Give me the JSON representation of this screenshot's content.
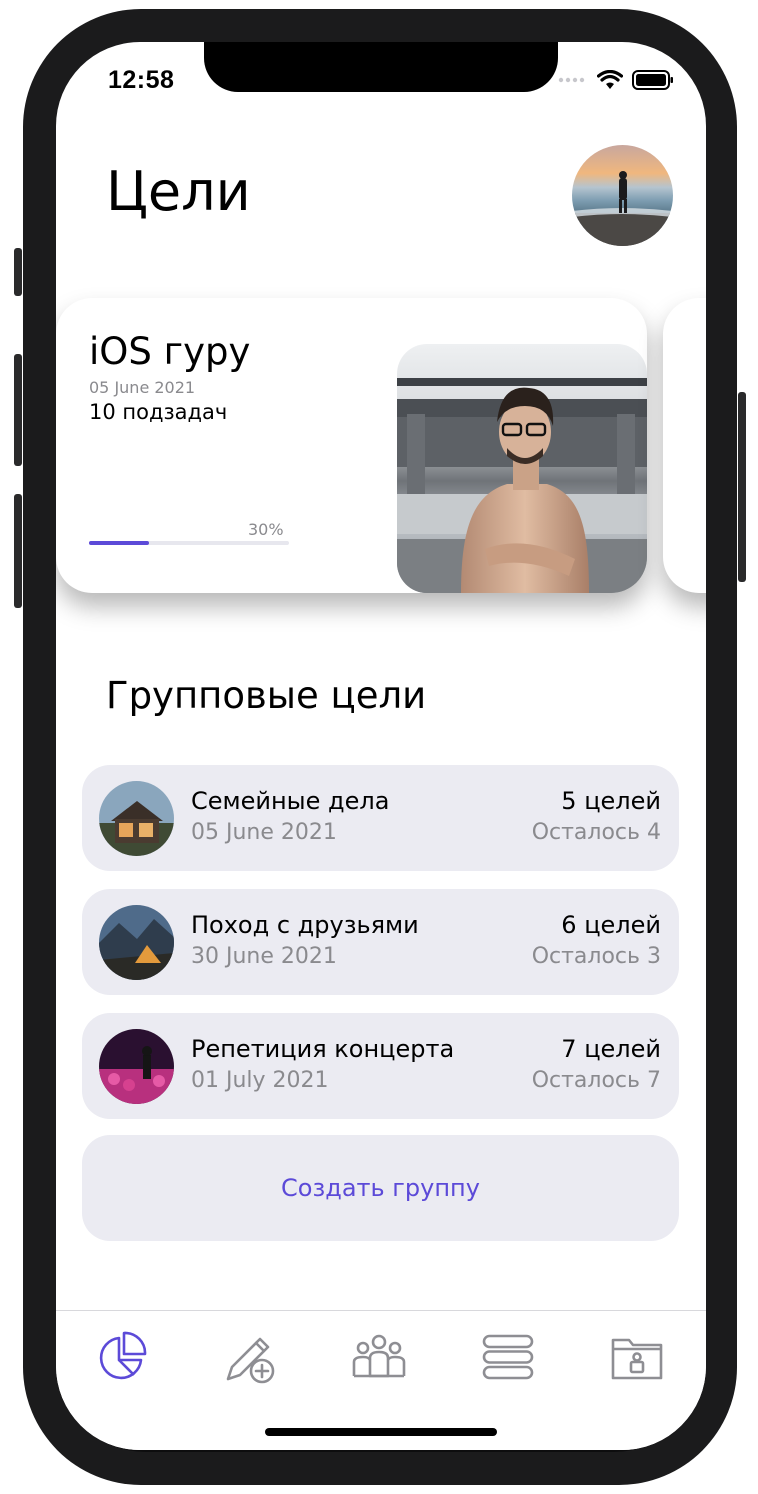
{
  "status_bar": {
    "time": "12:58"
  },
  "header": {
    "title": "Цели"
  },
  "goal_card": {
    "title": "iOS гуру",
    "date": "05 June 2021",
    "subtasks": "10 подзадач",
    "progress_label": "30%",
    "progress": 0.3
  },
  "groups": {
    "title": "Групповые цели",
    "items": [
      {
        "name": "Семейные дела",
        "date": "05 June 2021",
        "count": "5 целей",
        "remaining": "Осталось 4"
      },
      {
        "name": "Поход с друзьями",
        "date": "30 June 2021",
        "count": "6 целей",
        "remaining": "Осталось 3"
      },
      {
        "name": "Репетиция концерта",
        "date": "01 July 2021",
        "count": "7 целей",
        "remaining": "Осталось 7"
      }
    ],
    "create_label": "Создать группу"
  },
  "tabbar": {
    "items": [
      {
        "icon": "goals-pie-icon",
        "active": true
      },
      {
        "icon": "edit-add-icon",
        "active": false
      },
      {
        "icon": "people-icon",
        "active": false
      },
      {
        "icon": "list-icon",
        "active": false
      },
      {
        "icon": "folder-lock-icon",
        "active": false
      }
    ]
  },
  "colors": {
    "accent": "#5c4ad8",
    "group_bg": "#ebebf2",
    "secondary_text": "#8a8a8e",
    "inactive_icon": "#8e8e93"
  }
}
